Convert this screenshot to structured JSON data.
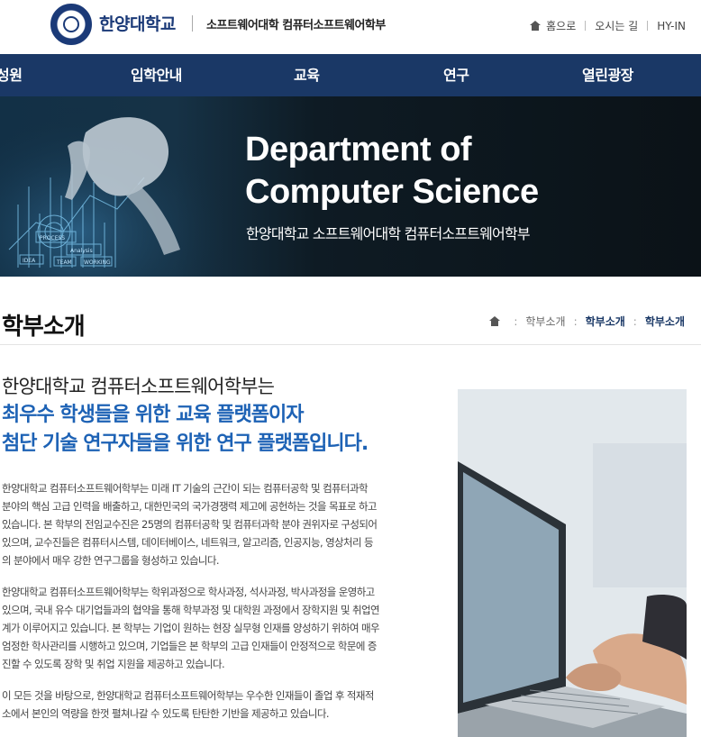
{
  "header": {
    "logo_text": "한양대학교",
    "seal_text": "한양 HANYANG UNIVERSITY 1939",
    "sub_title": "소프트웨어대학 컴퓨터소프트웨어학부",
    "util_links": [
      "홈으로",
      "오시는 길",
      "HY-IN"
    ]
  },
  "nav": {
    "items": [
      "성원",
      "입학안내",
      "교육",
      "연구",
      "열린광장"
    ]
  },
  "hero": {
    "title_line1": "Department of",
    "title_line2": "Computer Science",
    "subtitle": "한양대학교 소프트웨어대학 컴퓨터소프트웨어학부",
    "art_words": [
      "PROCESS",
      "Analysis",
      "IDEA",
      "TEAM",
      "WORKING"
    ]
  },
  "page": {
    "title": "학부소개",
    "breadcrumb": [
      "학부소개",
      "학부소개",
      "학부소개"
    ]
  },
  "intro": {
    "line1": "한양대학교 컴퓨터소프트웨어학부는",
    "highlight1": "최우수 학생들을 위한 교육 플랫폼이자",
    "highlight2": "첨단 기술 연구자들을 위한 연구 플랫폼입니다."
  },
  "paragraphs": [
    [
      "한양대학교 컴퓨터소프트웨어학부는 미래 IT 기술의 근간이 되는 컴퓨터공학 및 컴퓨터과학",
      "분야의 핵심 고급 인력을 배출하고, 대한민국의 국가경쟁력 제고에 공헌하는 것을 목표로 하고",
      "있습니다. 본 학부의 전임교수진은 25명의 컴퓨터공학 및 컴퓨터과학 분야 권위자로 구성되어",
      "있으며, 교수진들은 컴퓨터시스템, 데이터베이스, 네트워크, 알고리즘, 인공지능, 영상처리 등",
      "의 분야에서 매우 강한 연구그룹을 형성하고 있습니다."
    ],
    [
      "한양대학교 컴퓨터소프트웨어학부는 학위과정으로 학사과정, 석사과정, 박사과정을 운영하고",
      "있으며, 국내 유수 대기업들과의 협약을 통해 학부과정 및 대학원 과정에서 장학지원 및 취업연",
      "계가 이루어지고 있습니다. 본 학부는 기업이 원하는 현장 실무형 인재를 양성하기 위하여 매우",
      "엄정한 학사관리를 시행하고 있으며, 기업들은 본 학부의 고급 인재들이 안정적으로 학문에 증",
      "진할 수 있도록 장학 및 취업 지원을 제공하고 있습니다."
    ],
    [
      "이 모든 것을 바탕으로, 한양대학교 컴퓨터소프트웨어학부는 우수한 인재들이 졸업 후 적재적",
      "소에서 본인의 역량을 한껏 펼쳐나갈 수 있도록 탄탄한 기반을 제공하고 있습니다."
    ]
  ],
  "colors": {
    "nav_bg": "#1a3866",
    "accent_blue": "#1d62b5",
    "hero_bg": "#0e1b24"
  },
  "icons": [
    "university-seal-icon",
    "home-icon",
    "breadcrumb-home-icon"
  ]
}
